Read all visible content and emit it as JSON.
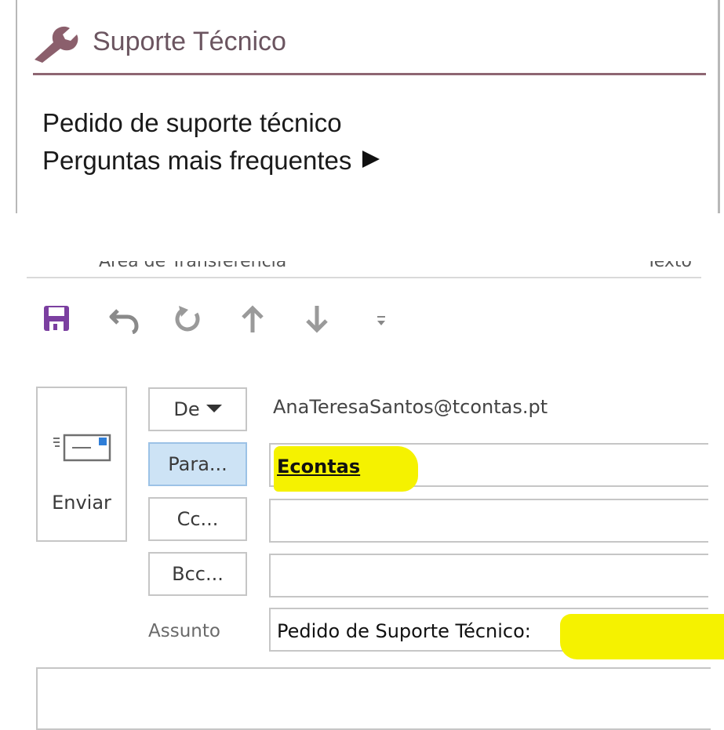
{
  "support_panel": {
    "title": "Suporte Técnico",
    "links": [
      {
        "label": "Pedido de suporte técnico"
      },
      {
        "label": "Perguntas mais frequentes"
      }
    ],
    "colors": {
      "title": "#6b5560",
      "divider": "#8e6672"
    }
  },
  "compose": {
    "ribbon_remnant": {
      "left_text": "Área de Transferência",
      "right_text": "Texto"
    },
    "quick_access": [
      "save-icon",
      "undo-icon",
      "redo-icon",
      "up-arrow-icon",
      "down-arrow-icon",
      "customize-icon"
    ],
    "send": {
      "label": "Enviar"
    },
    "from": {
      "button_label": "De",
      "value": "AnaTeresaSantos@tcontas.pt"
    },
    "to": {
      "button_label": "Para...",
      "value": "Econtas"
    },
    "cc": {
      "button_label": "Cc...",
      "value": ""
    },
    "bcc": {
      "button_label": "Bcc...",
      "value": ""
    },
    "subject": {
      "label": "Assunto",
      "value": "Pedido de Suporte Técnico:"
    },
    "body": {
      "value": ""
    },
    "colors": {
      "highlight": "#f5f200",
      "selected_button": "#cde3f5",
      "save_icon": "#7b3fa0"
    }
  }
}
